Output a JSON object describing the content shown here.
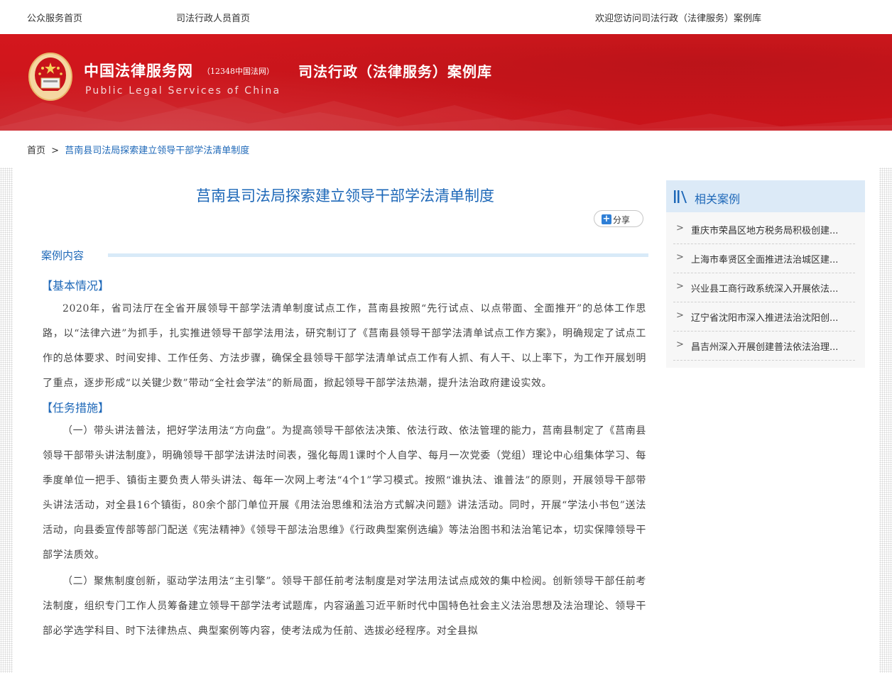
{
  "topbar": {
    "public_home": "公众服务首页",
    "staff_home": "司法行政人员首页",
    "welcome": "欢迎您访问司法行政（法律服务）案例库"
  },
  "banner": {
    "brand_cn": "中国法律服务网",
    "brand_sub": "（12348中国法网）",
    "brand_en": "Public Legal Services of China",
    "site_title": "司法行政（法律服务）案例库",
    "emblem_icon": "court-emblem-icon",
    "colors": {
      "banner_red": "#d4171d",
      "accent_blue": "#1e68b8"
    }
  },
  "breadcrumb": {
    "home": "首页",
    "separator": ">",
    "current": "莒南县司法局探索建立领导干部学法清单制度"
  },
  "article": {
    "title": "莒南县司法局探索建立领导干部学法清单制度",
    "share_label": "分享",
    "section_title": "案例内容",
    "heading_basic": "【基本情况】",
    "para_basic": "2020年，省司法厅在全省开展领导干部学法清单制度试点工作，莒南县按照“先行试点、以点带面、全面推开”的总体工作思路，以“法律六进”为抓手，扎实推进领导干部学法用法，研究制订了《莒南县领导干部学法清单试点工作方案》，明确规定了试点工作的总体要求、时间安排、工作任务、方法步骤，确保全县领导干部学法清单试点工作有人抓、有人干、以上率下，为工作开展划明了重点，逐步形成“以关键少数”带动“全社会学法”的新局面，掀起领导干部学法热潮，提升法治政府建设实效。",
    "heading_tasks": "【任务措施】",
    "para_task1": "（一）带头讲法普法，把好学法用法“方向盘”。为提高领导干部依法决策、依法行政、依法管理的能力，莒南县制定了《莒南县领导干部带头讲法制度》，明确领导干部学法讲法时间表，强化每周1课时个人自学、每月一次党委（党组）理论中心组集体学习、每季度单位一把手、镇街主要负责人带头讲法、每年一次网上考法“4个1”学习模式。按照“谁执法、谁普法”的原则，开展领导干部带头讲法活动，对全县16个镇街，80余个部门单位开展《用法治思维和法治方式解决问题》讲法活动。同时，开展“学法小书包”送法活动，向县委宣传部等部门配送《宪法精神》《领导干部法治思维》《行政典型案例选编》等法治图书和法治笔记本，切实保障领导干部学法质效。",
    "para_task2": "（二）聚焦制度创新，驱动学法用法“主引擎”。领导干部任前考法制度是对学法用法试点成效的集中检阅。创新领导干部任前考法制度，组织专门工作人员筹备建立领导干部学法考试题库，内容涵盖习近平新时代中国特色社会主义法治思想及法治理论、领导干部必学选学科目、时下法律热点、典型案例等内容，使考法成为任前、选拔必经程序。对全县拟"
  },
  "sidebar": {
    "title": "相关案例",
    "icon": "list-bars-icon",
    "items": [
      {
        "label": "重庆市荣昌区地方税务局积极创建..."
      },
      {
        "label": "上海市奉贤区全面推进法治城区建..."
      },
      {
        "label": "兴业县工商行政系统深入开展依法..."
      },
      {
        "label": "辽宁省沈阳市深入推进法治沈阳创..."
      },
      {
        "label": "昌吉州深入开展创建普法依法治理..."
      }
    ]
  }
}
